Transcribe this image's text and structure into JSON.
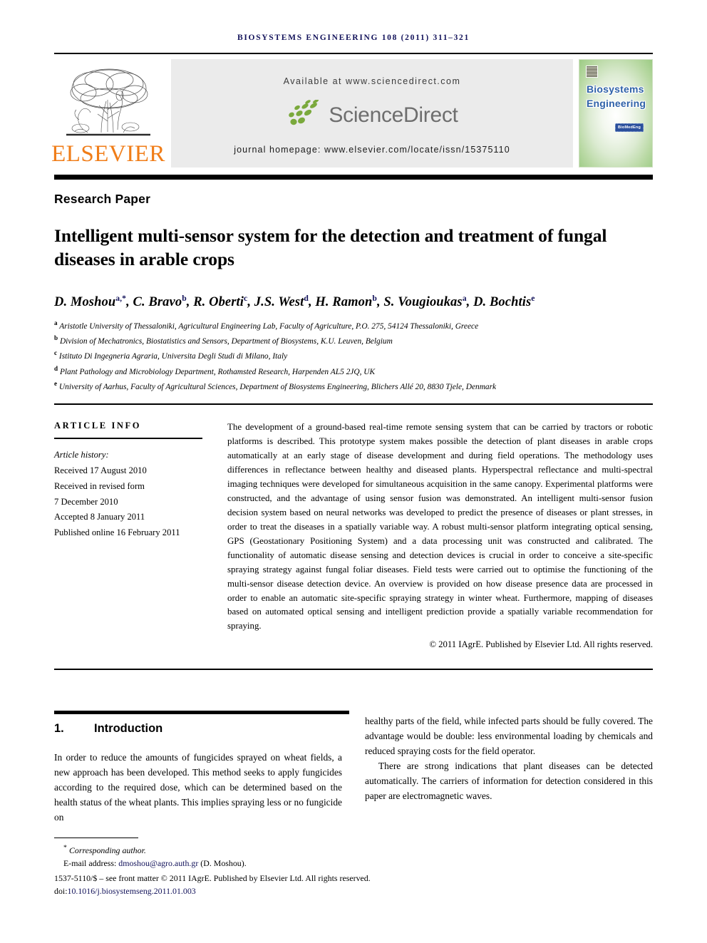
{
  "running_head": "Biosystems Engineering 108 (2011) 311–321",
  "masthead": {
    "publisher_name": "ELSEVIER",
    "publisher_logo_name": "elsevier-tree-logo",
    "available_at": "Available at www.sciencedirect.com",
    "sciencedirect_logo_text": "ScienceDirect",
    "journal_homepage": "journal homepage: www.elsevier.com/locate/issn/15375110",
    "cover": {
      "title_line1": "Biosystems",
      "title_line2": "Engineering",
      "badge": "BioMedEng"
    }
  },
  "article": {
    "type": "Research Paper",
    "title": "Intelligent multi-sensor system for the detection and treatment of fungal diseases in arable crops",
    "authors_html": "D. Moshou<sup>a,*</sup>, C. Bravo<sup>b</sup>, R. Oberti<sup>c</sup>, J.S. West<sup>d</sup>, H. Ramon<sup>b</sup>, S. Vougioukas<sup>a</sup>, D. Bochtis<sup>e</sup>",
    "affiliations": [
      {
        "marker": "a",
        "text": "Aristotle University of Thessaloniki, Agricultural Engineering Lab, Faculty of Agriculture, P.O. 275, 54124 Thessaloniki, Greece"
      },
      {
        "marker": "b",
        "text": "Division of Mechatronics, Biostatistics and Sensors, Department of Biosystems, K.U. Leuven, Belgium"
      },
      {
        "marker": "c",
        "text": "Istituto Di Ingegneria Agraria, Universita Degli Studi di Milano, Italy"
      },
      {
        "marker": "d",
        "text": "Plant Pathology and Microbiology Department, Rothamsted Research, Harpenden AL5 2JQ, UK"
      },
      {
        "marker": "e",
        "text": "University of Aarhus, Faculty of Agricultural Sciences, Department of Biosystems Engineering, Blichers Allé 20, 8830 Tjele, Denmark"
      }
    ]
  },
  "article_info": {
    "heading": "ARTICLE INFO",
    "history_label": "Article history:",
    "received": "Received 17 August 2010",
    "revised_label": "Received in revised form",
    "revised_date": "7 December 2010",
    "accepted": "Accepted 8 January 2011",
    "published": "Published online 16 February 2011"
  },
  "abstract": {
    "text": "The development of a ground-based real-time remote sensing system that can be carried by tractors or robotic platforms is described. This prototype system makes possible the detection of plant diseases in arable crops automatically at an early stage of disease development and during field operations. The methodology uses differences in reflectance between healthy and diseased plants. Hyperspectral reflectance and multi-spectral imaging techniques were developed for simultaneous acquisition in the same canopy. Experimental platforms were constructed, and the advantage of using sensor fusion was demonstrated. An intelligent multi-sensor fusion decision system based on neural networks was developed to predict the presence of diseases or plant stresses, in order to treat the diseases in a spatially variable way. A robust multi-sensor platform integrating optical sensing, GPS (Geostationary Positioning System) and a data processing unit was constructed and calibrated. The functionality of automatic disease sensing and detection devices is crucial in order to conceive a site-specific spraying strategy against fungal foliar diseases. Field tests were carried out to optimise the functioning of the multi-sensor disease detection device. An overview is provided on how disease presence data are processed in order to enable an automatic site-specific spraying strategy in winter wheat. Furthermore, mapping of diseases based on automated optical sensing and intelligent prediction provide a spatially variable recommendation for spraying.",
    "copyright": "© 2011 IAgrE. Published by Elsevier Ltd. All rights reserved."
  },
  "introduction": {
    "number": "1.",
    "heading": "Introduction",
    "left_para": "In order to reduce the amounts of fungicides sprayed on wheat fields, a new approach has been developed. This method seeks to apply fungicides according to the required dose, which can be determined based on the health status of the wheat plants. This implies spraying less or no fungicide on",
    "right_para_1": "healthy parts of the field, while infected parts should be fully covered. The advantage would be double: less environmental loading by chemicals and reduced spraying costs for the field operator.",
    "right_para_2": "There are strong indications that plant diseases can be detected automatically. The carriers of information for detection considered in this paper are electromagnetic waves."
  },
  "footer": {
    "corresponding_marker": "*",
    "corresponding": "Corresponding author.",
    "email_label": "E-mail address:",
    "email": "dmoshou@agro.auth.gr",
    "email_owner": "(D. Moshou).",
    "front_matter": "1537-5110/$ – see front matter © 2011 IAgrE. Published by Elsevier Ltd. All rights reserved.",
    "doi_label": "doi:",
    "doi": "10.1016/j.biosystemseng.2011.01.003"
  },
  "colors": {
    "link": "#12125a",
    "elsevier_orange": "#f07d18",
    "sciencedirect_green": "#7aa93c",
    "sciencedirect_gray": "#6e6e6e"
  }
}
